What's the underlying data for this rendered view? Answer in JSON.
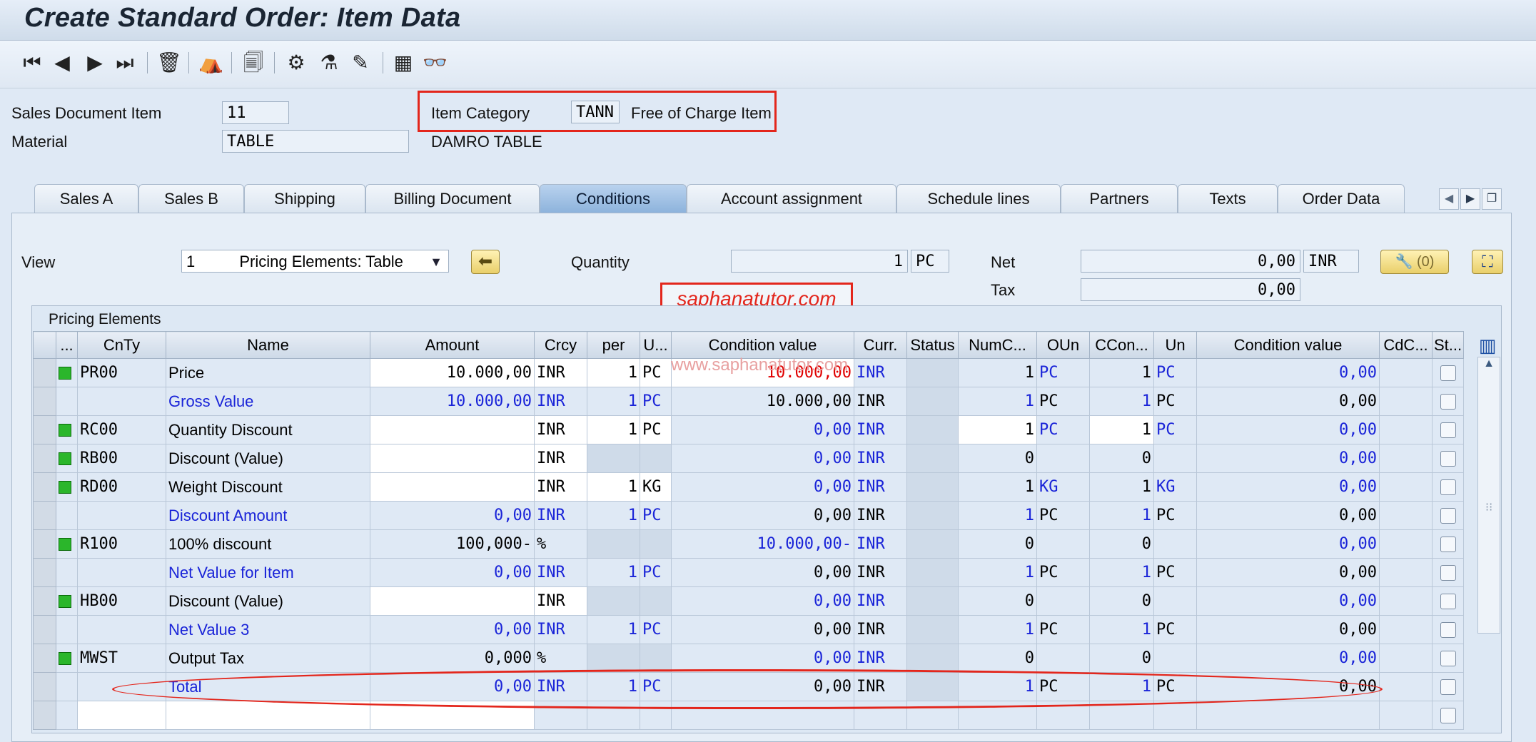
{
  "window": {
    "title": "Create Standard Order: Item Data"
  },
  "toolbar": {
    "icons": [
      "first-page-icon",
      "previous-page-icon",
      "next-page-icon",
      "last-page-icon",
      "delete-icon",
      "header-icon",
      "display-document-icon",
      "configuration-icon",
      "batch-icon",
      "edit-notes-icon",
      "calculator-icon",
      "glasses-icon"
    ]
  },
  "header": {
    "item_label": "Sales Document Item",
    "item_value": "11",
    "material_label": "Material",
    "material_value": "TABLE",
    "material_desc": "DAMRO TABLE",
    "category_label": "Item Category",
    "category_code": "TANN",
    "category_desc": "Free of Charge Item"
  },
  "tabs": [
    "Sales A",
    "Sales B",
    "Shipping",
    "Billing Document",
    "Conditions",
    "Account assignment",
    "Schedule lines",
    "Partners",
    "Texts",
    "Order Data"
  ],
  "active_tab": "Conditions",
  "conditions": {
    "view_label": "View",
    "view_value_num": "1",
    "view_value_text": "Pricing Elements: Table",
    "quantity_label": "Quantity",
    "quantity_value": "1",
    "quantity_unit": "PC",
    "net_label": "Net",
    "net_value": "0,00",
    "net_currency": "INR",
    "tax_label": "Tax",
    "tax_value": "0,00",
    "button_count": "(0)"
  },
  "watermark": {
    "boxed": "saphanatutor.com",
    "faint": "www.saphanatutor.com"
  },
  "table": {
    "title": "Pricing Elements",
    "columns": [
      "...",
      "CnTy",
      "Name",
      "Amount",
      "Crcy",
      "per",
      "U...",
      "Condition value",
      "Curr.",
      "Status",
      "NumC...",
      "OUn",
      "CCon...",
      "Un",
      "Condition value",
      "CdC...",
      "St..."
    ],
    "rows": [
      {
        "cnty": "PR00",
        "name": "Price",
        "amount": "10.000,00",
        "crcy": "INR",
        "per": "1",
        "u": "PC",
        "cval": "10.000,00",
        "curr": "INR",
        "num": "1",
        "oun": "PC",
        "ccon": "1",
        "un": "PC",
        "cval2": "0,00"
      },
      {
        "cnty": "",
        "name": "Gross Value",
        "amount": "10.000,00",
        "crcy": "INR",
        "per": "1",
        "u": "PC",
        "cval": "10.000,00",
        "curr": "INR",
        "num": "1",
        "oun": "PC",
        "ccon": "1",
        "un": "PC",
        "cval2": "0,00"
      },
      {
        "cnty": "RC00",
        "name": "Quantity Discount",
        "amount": "",
        "crcy": "INR",
        "per": "1",
        "u": "PC",
        "cval": "0,00",
        "curr": "INR",
        "num": "1",
        "oun": "PC",
        "ccon": "1",
        "un": "PC",
        "cval2": "0,00"
      },
      {
        "cnty": "RB00",
        "name": "Discount (Value)",
        "amount": "",
        "crcy": "INR",
        "per": "",
        "u": "",
        "cval": "0,00",
        "curr": "INR",
        "num": "0",
        "oun": "",
        "ccon": "0",
        "un": "",
        "cval2": "0,00"
      },
      {
        "cnty": "RD00",
        "name": "Weight Discount",
        "amount": "",
        "crcy": "INR",
        "per": "1",
        "u": "KG",
        "cval": "0,00",
        "curr": "INR",
        "num": "1",
        "oun": "KG",
        "ccon": "1",
        "un": "KG",
        "cval2": "0,00"
      },
      {
        "cnty": "",
        "name": "Discount Amount",
        "amount": "0,00",
        "crcy": "INR",
        "per": "1",
        "u": "PC",
        "cval": "0,00",
        "curr": "INR",
        "num": "1",
        "oun": "PC",
        "ccon": "1",
        "un": "PC",
        "cval2": "0,00"
      },
      {
        "cnty": "R100",
        "name": "100% discount",
        "amount": "100,000-",
        "crcy": "%",
        "per": "",
        "u": "",
        "cval": "10.000,00-",
        "curr": "INR",
        "num": "0",
        "oun": "",
        "ccon": "0",
        "un": "",
        "cval2": "0,00"
      },
      {
        "cnty": "",
        "name": "Net Value for Item",
        "amount": "0,00",
        "crcy": "INR",
        "per": "1",
        "u": "PC",
        "cval": "0,00",
        "curr": "INR",
        "num": "1",
        "oun": "PC",
        "ccon": "1",
        "un": "PC",
        "cval2": "0,00"
      },
      {
        "cnty": "HB00",
        "name": "Discount (Value)",
        "amount": "",
        "crcy": "INR",
        "per": "",
        "u": "",
        "cval": "0,00",
        "curr": "INR",
        "num": "0",
        "oun": "",
        "ccon": "0",
        "un": "",
        "cval2": "0,00"
      },
      {
        "cnty": "",
        "name": "Net Value 3",
        "amount": "0,00",
        "crcy": "INR",
        "per": "1",
        "u": "PC",
        "cval": "0,00",
        "curr": "INR",
        "num": "1",
        "oun": "PC",
        "ccon": "1",
        "un": "PC",
        "cval2": "0,00"
      },
      {
        "cnty": "MWST",
        "name": "Output Tax",
        "amount": "0,000",
        "crcy": "%",
        "per": "",
        "u": "",
        "cval": "0,00",
        "curr": "INR",
        "num": "0",
        "oun": "",
        "ccon": "0",
        "un": "",
        "cval2": "0,00"
      },
      {
        "cnty": "",
        "name": "Total",
        "amount": "0,00",
        "crcy": "INR",
        "per": "1",
        "u": "PC",
        "cval": "0,00",
        "curr": "INR",
        "num": "1",
        "oun": "PC",
        "ccon": "1",
        "un": "PC",
        "cval2": "0,00"
      }
    ]
  }
}
